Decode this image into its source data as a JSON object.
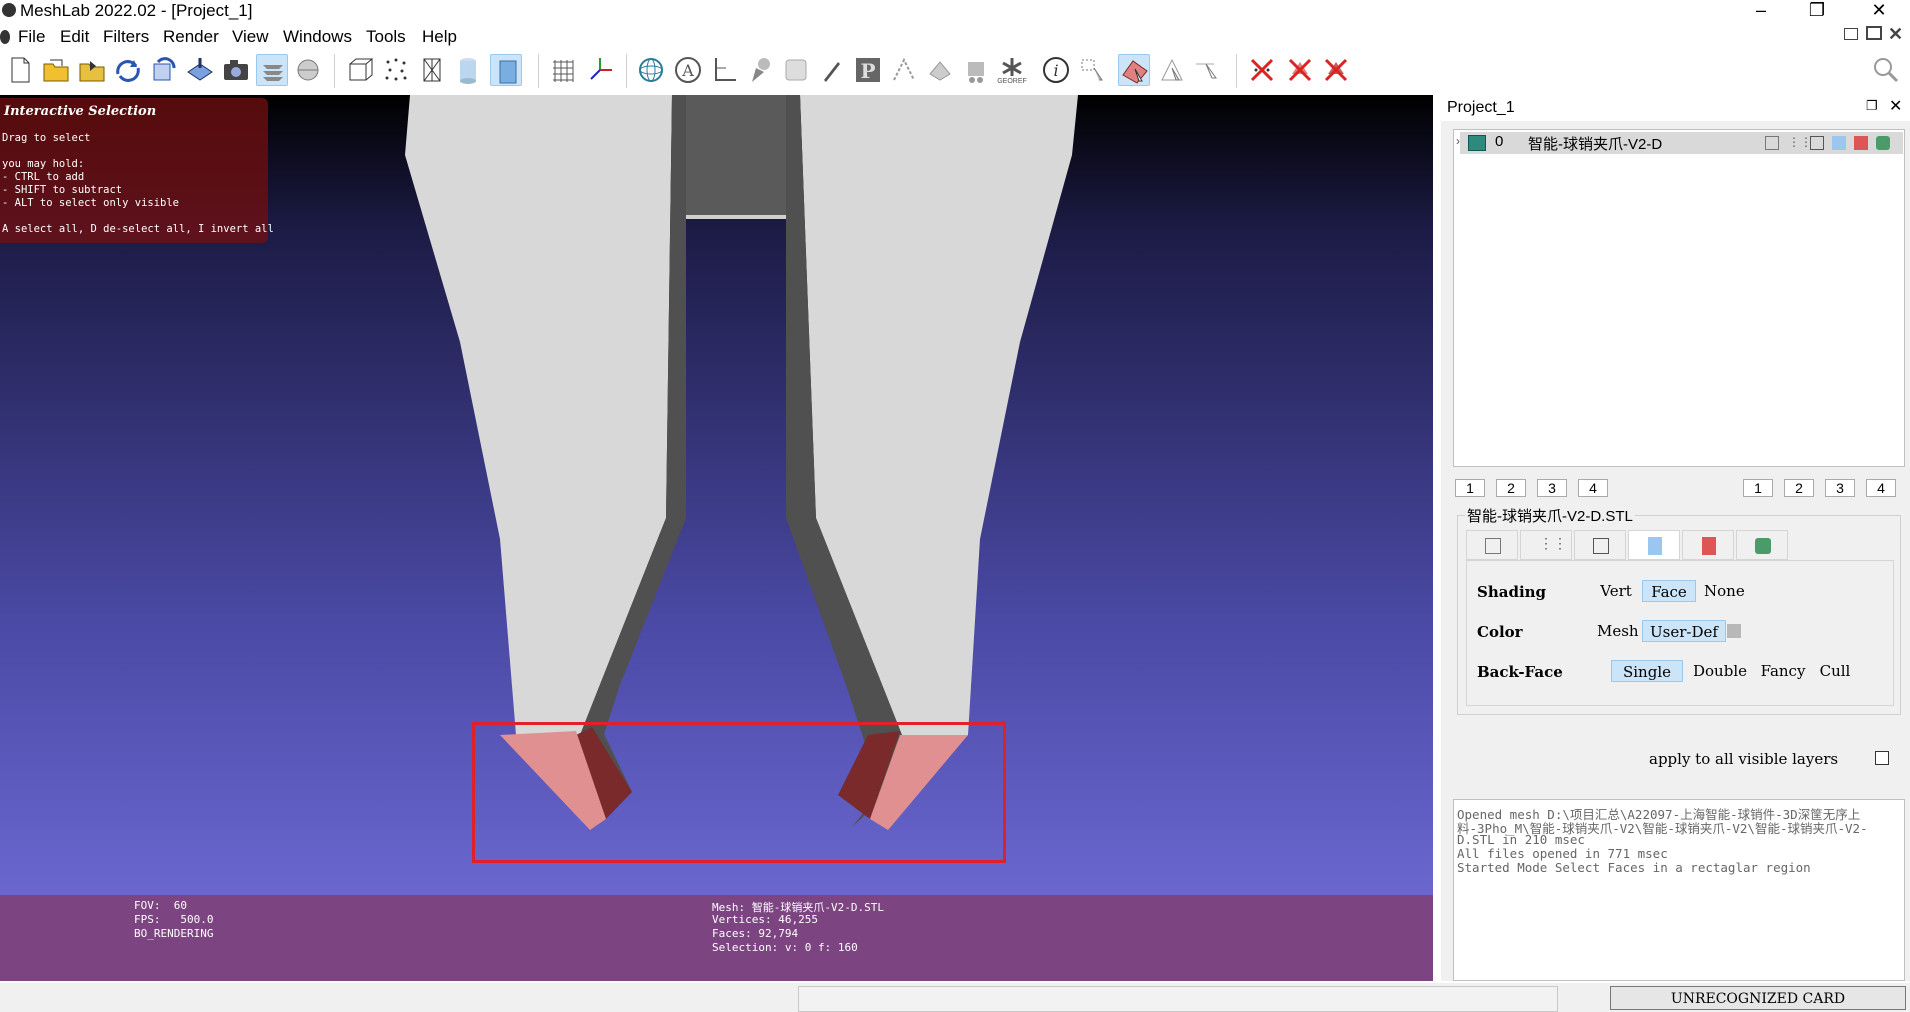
{
  "window": {
    "title": "MeshLab 2022.02 - [Project_1]"
  },
  "menu": [
    "File",
    "Edit",
    "Filters",
    "Render",
    "View",
    "Windows",
    "Tools",
    "Help"
  ],
  "toolbar": {
    "icons": [
      "new-project-icon",
      "open-project-icon",
      "import-mesh-icon",
      "reload-icon",
      "reload-all-icon",
      "export-mesh-icon",
      "snapshot-icon",
      "layers-icon",
      "ambient-occlusion-icon",
      "bounding-box-icon",
      "points-icon",
      "wireframe-icon",
      "flat-icon",
      "smooth-icon",
      "grid-icon",
      "axis-icon",
      "trackball-icon",
      "label-icon",
      "measure-icon",
      "paint-icon",
      "pick-icon",
      "p-icon",
      "align-icon",
      "manipulate-icon",
      "robot-icon",
      "georef-icon",
      "info-icon",
      "select-vertices-icon",
      "select-faces-rect-icon",
      "select-connected-icon",
      "select-point-icon",
      "delete-vertices-icon",
      "delete-faces-icon",
      "delete-all-icon"
    ],
    "georef_label": "GEOREF"
  },
  "selection_help": {
    "title": "Interactive Selection",
    "lines": [
      "Drag to select",
      "",
      "you may hold:",
      "- CTRL to add",
      "- SHIFT to subtract",
      "- ALT to select only visible",
      "",
      "A select all, D de-select all, I invert all"
    ]
  },
  "viewport_info": {
    "fov": "FOV:  60",
    "fps": "FPS:   500.0",
    "rendering": "BO_RENDERING",
    "mesh": "Mesh: 智能-球销夹爪-V2-D.STL",
    "vertices": "Vertices: 46,255",
    "faces": "Faces: 92,794",
    "selection": "Selection: v: 0 f: 160"
  },
  "project": {
    "title": "Project_1",
    "layer_index": "0",
    "layer_name": "智能-球销夹爪-V2-D",
    "view_buttons": [
      "1",
      "2",
      "3",
      "4"
    ]
  },
  "mesh_props": {
    "title": "智能-球销夹爪-V2-D.STL",
    "shading_label": "Shading",
    "shading_options": [
      "Vert",
      "Face",
      "None"
    ],
    "color_label": "Color",
    "color_options": [
      "Mesh",
      "User-Def"
    ],
    "backface_label": "Back-Face",
    "backface_options": [
      "Single",
      "Double",
      "Fancy",
      "Cull"
    ],
    "apply_all": "apply to all visible layers",
    "color_swatch": "#b8b8b8"
  },
  "log": [
    "Opened mesh D:\\项目汇总\\A22097-上海智能-球销件-3D深筐无序上",
    "料-3Pho_M\\智能-球销夹爪-V2\\智能-球销夹爪-V2\\智能-球销夹爪-V2-",
    "D.STL in 210 msec",
    "All files opened in 771 msec",
    "Started Mode Select Faces in a rectaglar region"
  ],
  "status": {
    "card": "UNRECOGNIZED CARD"
  }
}
